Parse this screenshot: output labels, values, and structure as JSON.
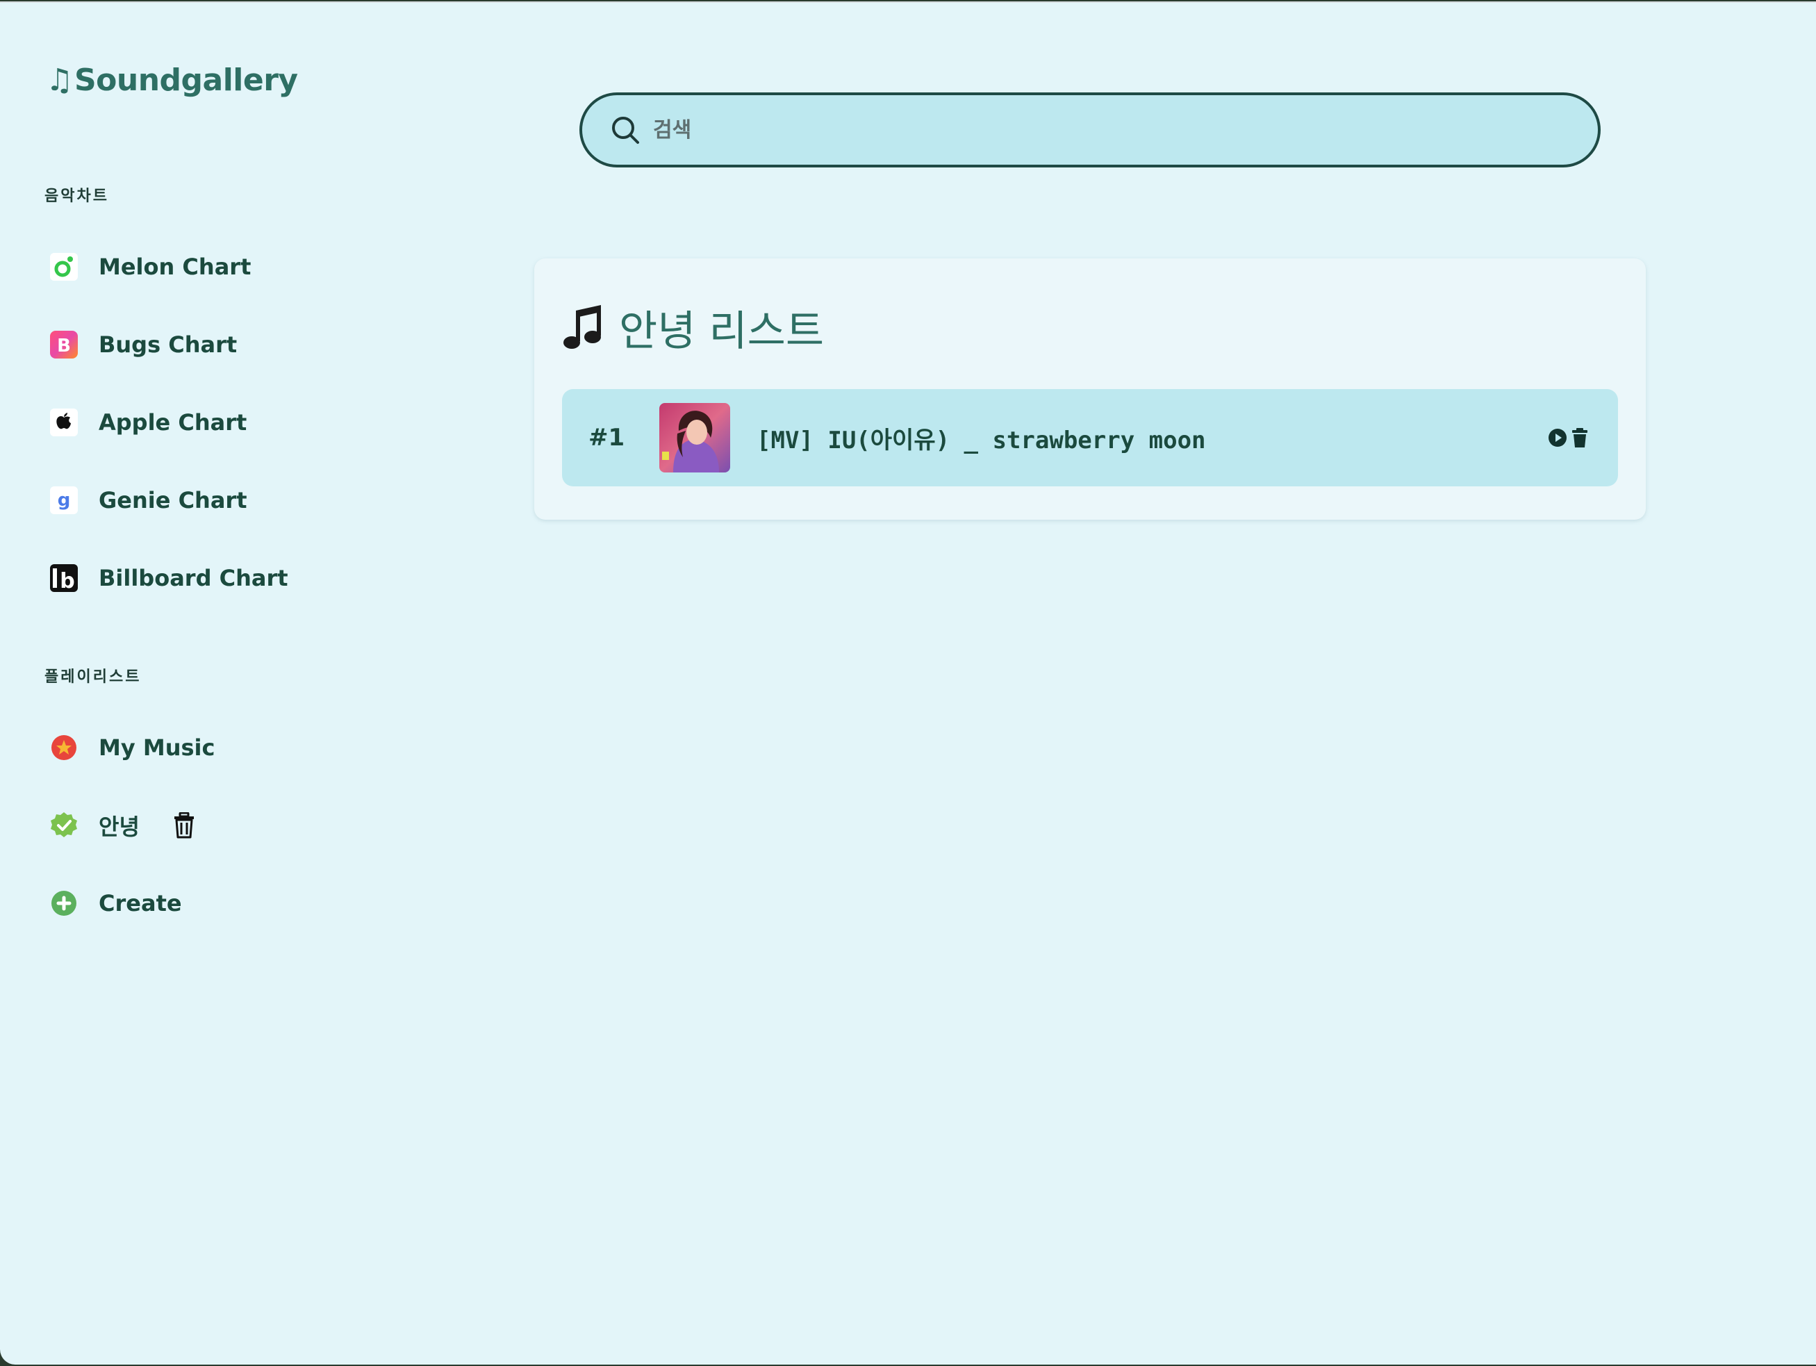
{
  "app": {
    "logo": "Soundgallery",
    "logo_icon": "music-note-icon"
  },
  "sidebar": {
    "charts_title": "음악차트",
    "charts": [
      {
        "label": "Melon Chart",
        "icon": "melon-icon"
      },
      {
        "label": "Bugs Chart",
        "icon": "bugs-icon"
      },
      {
        "label": "Apple Chart",
        "icon": "apple-icon"
      },
      {
        "label": "Genie Chart",
        "icon": "genie-icon"
      },
      {
        "label": "Billboard Chart",
        "icon": "billboard-icon"
      }
    ],
    "playlists_title": "플레이리스트",
    "playlists": [
      {
        "label": "My Music",
        "icon": "star-badge-icon"
      },
      {
        "label": "안녕",
        "icon": "check-badge-icon",
        "delete_icon": "trash-icon"
      },
      {
        "label": "Create",
        "icon": "plus-circle-icon"
      }
    ]
  },
  "search": {
    "placeholder": "검색",
    "value": ""
  },
  "playlist": {
    "title": "안녕 리스트",
    "title_icon": "music-notes-icon",
    "tracks": [
      {
        "rank": "#1",
        "title": "[MV] IU(아이유) _ strawberry moon",
        "actions": [
          "play-icon",
          "trash-icon"
        ]
      }
    ]
  },
  "colors": {
    "background": "#e3f5f9",
    "accent": "#2e6f64",
    "text": "#1b4a3e",
    "search_bg": "#bde8ef",
    "search_border": "#1e4a45",
    "row_bg": "#bde8ef"
  }
}
